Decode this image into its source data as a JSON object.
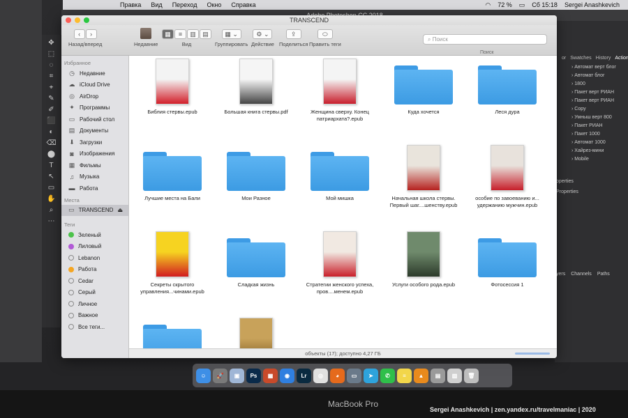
{
  "menubar": {
    "items": [
      "Правка",
      "Вид",
      "Переход",
      "Окно",
      "Справка"
    ],
    "battery": "72 %",
    "clock": "Сб 15:18",
    "user": "Sergei Anashkevich"
  },
  "photoshop": {
    "title": "Adobe Photoshop CC 2018",
    "panel_tabs": [
      "or",
      "Swatches",
      "History",
      "Action"
    ],
    "actions": [
      "Автомат верт блог",
      "Автомат блог",
      "1800",
      "Пакет верт РИАН",
      "Пакет верт РИАН",
      "Copy",
      "Умныш верт 800",
      "Пакет РИАН",
      "Пакет 1000",
      "Автомат 1000",
      "Хайрез-мини",
      "Mobile"
    ],
    "properties": [
      "operties",
      "Properties"
    ],
    "layers_tabs": [
      "yers",
      "Channels",
      "Paths"
    ]
  },
  "finder": {
    "title": "TRANSCEND",
    "toolbar": {
      "back_forward": "Назад/вперед",
      "recents": "Недавние",
      "view": "Вид",
      "group": "Группировать",
      "action": "Действие",
      "share": "Поделиться",
      "tags": "Править теги"
    },
    "search": {
      "placeholder": "Поиск",
      "column": "Поиск"
    },
    "sidebar": {
      "favorites_heading": "Избранное",
      "favorites": [
        {
          "label": "Недавние",
          "icon": "clock-icon"
        },
        {
          "label": "iCloud Drive",
          "icon": "cloud-icon"
        },
        {
          "label": "AirDrop",
          "icon": "airdrop-icon"
        },
        {
          "label": "Программы",
          "icon": "apps-icon"
        },
        {
          "label": "Рабочий стол",
          "icon": "desktop-icon"
        },
        {
          "label": "Документы",
          "icon": "document-icon"
        },
        {
          "label": "Загрузки",
          "icon": "download-icon"
        },
        {
          "label": "Изображения",
          "icon": "camera-icon"
        },
        {
          "label": "Фильмы",
          "icon": "film-icon"
        },
        {
          "label": "Музыка",
          "icon": "music-icon"
        },
        {
          "label": "Работа",
          "icon": "folder-icon"
        }
      ],
      "places_heading": "Места",
      "device": "TRANSCEND",
      "tags_heading": "Теги",
      "tags": [
        {
          "label": "Зеленый",
          "color": "#4cc24a"
        },
        {
          "label": "Лиловый",
          "color": "#b25ad6"
        },
        {
          "label": "Lebanon",
          "color": "none"
        },
        {
          "label": "Работа",
          "color": "#f5a623"
        },
        {
          "label": "Cedar",
          "color": "none"
        },
        {
          "label": "Серый",
          "color": "none"
        },
        {
          "label": "Личное",
          "color": "none"
        },
        {
          "label": "Важное",
          "color": "none"
        },
        {
          "label": "Все теги...",
          "color": "none"
        }
      ]
    },
    "items": [
      {
        "name": "Библия стервы.epub",
        "kind": "book",
        "colors": [
          "#f3f3f3",
          "#d21f2a"
        ]
      },
      {
        "name": "Большая книга стервы.pdf",
        "kind": "book",
        "colors": [
          "#f5f5f5",
          "#444444"
        ]
      },
      {
        "name": "Женщина сверху. Конец патриархата?.epub",
        "kind": "book",
        "colors": [
          "#f4f4f4",
          "#c81e2c"
        ]
      },
      {
        "name": "Куда хочется",
        "kind": "folder"
      },
      {
        "name": "Леся дура",
        "kind": "folder"
      },
      {
        "name": "Лучшие места на Бали",
        "kind": "folder"
      },
      {
        "name": "Мои Разное",
        "kind": "folder"
      },
      {
        "name": "Мой мишка",
        "kind": "folder"
      },
      {
        "name": "Начальная школа стервы. Первый шаг....шенству.epub",
        "kind": "book",
        "colors": [
          "#e9e4dc",
          "#b6221f"
        ]
      },
      {
        "name": "особие по завоеванию и... удержанию мужчин.epub",
        "kind": "book",
        "colors": [
          "#e8e2dc",
          "#c71f2b"
        ]
      },
      {
        "name": "Секреты скрытого управления...чинами.epub",
        "kind": "book",
        "colors": [
          "#f6d321",
          "#d11c1f"
        ]
      },
      {
        "name": "Сладкая жизнь",
        "kind": "folder"
      },
      {
        "name": "Стратегии женского успеха, пров....менем.epub",
        "kind": "book",
        "colors": [
          "#f1e9e2",
          "#c9202b"
        ]
      },
      {
        "name": "Услуги особого рода.epub",
        "kind": "book",
        "colors": [
          "#6f8a6c",
          "#2c3a2a"
        ]
      },
      {
        "name": "Фотосессия 1",
        "kind": "folder"
      },
      {
        "name": "",
        "kind": "folder"
      },
      {
        "name": "",
        "kind": "book",
        "colors": [
          "#c8a25a",
          "#7d5a22"
        ]
      }
    ],
    "status": "объекты (17); доступно 4,27 ГБ"
  },
  "dock": {
    "apps": [
      {
        "name": "Finder",
        "color": "#3e8fe6",
        "glyph": "☺"
      },
      {
        "name": "Launchpad",
        "color": "#7a7a7a",
        "glyph": "🚀"
      },
      {
        "name": "Preview",
        "color": "#9fb6d6",
        "glyph": "▣"
      },
      {
        "name": "Photoshop",
        "color": "#0a2a4a",
        "glyph": "Ps"
      },
      {
        "name": "Photo Booth",
        "color": "#c84a2a",
        "glyph": "▦"
      },
      {
        "name": "Safari",
        "color": "#2f7fe0",
        "glyph": "◉"
      },
      {
        "name": "Lightroom",
        "color": "#0a2a40",
        "glyph": "Lr"
      },
      {
        "name": "Chrome",
        "color": "#e0e0e0",
        "glyph": "◎"
      },
      {
        "name": "Firefox",
        "color": "#e56a1c",
        "glyph": "◕"
      },
      {
        "name": "Screenshot",
        "color": "#6a7a8a",
        "glyph": "▭"
      },
      {
        "name": "Telegram",
        "color": "#2ea3dc",
        "glyph": "➤"
      },
      {
        "name": "WhatsApp",
        "color": "#2fbf4a",
        "glyph": "✆"
      },
      {
        "name": "Notes",
        "color": "#f2d64a",
        "glyph": "≡"
      },
      {
        "name": "VLC",
        "color": "#e98a1c",
        "glyph": "▲"
      },
      {
        "name": "Monitor",
        "color": "#9a9a9a",
        "glyph": "▤"
      },
      {
        "name": "Remote",
        "color": "#cfcfcf",
        "glyph": "▥"
      },
      {
        "name": "Trash",
        "color": "#bdbdbd",
        "glyph": "🗑"
      }
    ]
  },
  "laptop": {
    "brand": "MacBook Pro",
    "credit": "Sergei Anashkevich | zen.yandex.ru/travelmaniac | 2020"
  }
}
